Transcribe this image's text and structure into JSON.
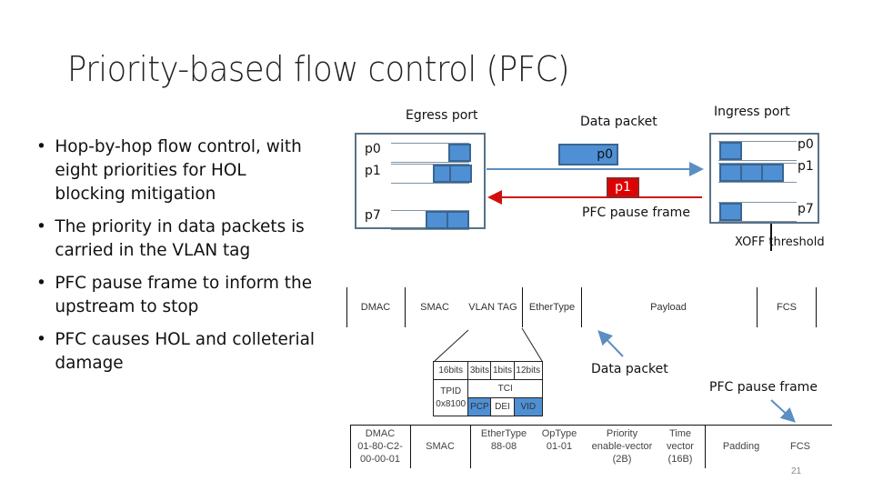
{
  "slide": {
    "title": "Priority-based flow control (PFC)",
    "bullets": [
      "Hop-by-hop flow control, with eight priorities for HOL blocking mitigation",
      "The priority in data packets is carried in the VLAN tag",
      "PFC pause frame to inform the upstream to stop",
      "PFC causes HOL and colleterial damage"
    ],
    "page_number": "21"
  },
  "diagram": {
    "egress_port": {
      "label": "Egress port",
      "queues": [
        {
          "name": "p0",
          "occupied_cells": 1
        },
        {
          "name": "p1",
          "occupied_cells": 2
        },
        {
          "name": "p7",
          "occupied_cells": 2
        }
      ]
    },
    "ingress_port": {
      "label": "Ingress port",
      "queues": [
        {
          "name": "p0",
          "occupied_cells": 1
        },
        {
          "name": "p1",
          "occupied_cells": 3
        },
        {
          "name": "p7",
          "occupied_cells": 1
        }
      ],
      "threshold_label": "XOFF threshold"
    },
    "data_packet": {
      "label": "Data packet",
      "priority": "p0",
      "color": "#4f8fd4"
    },
    "pause_frame": {
      "label": "PFC pause frame",
      "priority": "p1",
      "color": "#e00000"
    },
    "data_frame_format": {
      "fields": [
        "DMAC",
        "SMAC",
        "VLAN TAG",
        "EtherType",
        "Payload",
        "FCS"
      ],
      "callout_label": "Data packet"
    },
    "vlan_tag": {
      "sizes": [
        "16bits",
        "3bits",
        "1bits",
        "12bits"
      ],
      "tpid": "TPID",
      "tpid_value": "0x8100",
      "tci": "TCI",
      "subfields": [
        "PCP",
        "DEI",
        "VID"
      ]
    },
    "pause_frame_format": {
      "callout_label": "PFC pause frame",
      "fields": [
        {
          "name": "DMAC",
          "value": "01-80-C2-00-00-01"
        },
        {
          "name": "SMAC",
          "value": ""
        },
        {
          "name": "EtherType",
          "value": "88-08"
        },
        {
          "name": "OpType",
          "value": "01-01"
        },
        {
          "name": "Priority enable-vector (2B)",
          "value": ""
        },
        {
          "name": "Time vector (16B)",
          "value": ""
        },
        {
          "name": "Padding",
          "value": ""
        },
        {
          "name": "FCS",
          "value": ""
        }
      ]
    }
  }
}
